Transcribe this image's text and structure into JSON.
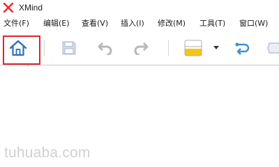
{
  "app": {
    "title": "XMind",
    "logo_icon": "xmind-logo-icon",
    "logo_color": "#e0312f"
  },
  "menu": {
    "items": [
      {
        "label": "文件(F)"
      },
      {
        "label": "编辑(E)"
      },
      {
        "label": "查看(V)"
      },
      {
        "label": "插入(I)"
      },
      {
        "label": "修改(M)"
      },
      {
        "label": "工具(T)"
      },
      {
        "label": "窗口(W)"
      }
    ]
  },
  "toolbar": {
    "buttons": [
      {
        "name": "home-icon"
      },
      {
        "name": "save-icon"
      },
      {
        "name": "undo-icon"
      },
      {
        "name": "redo-icon"
      },
      {
        "name": "topic-style-icon"
      },
      {
        "name": "dropdown-arrow-icon"
      },
      {
        "name": "relationship-icon"
      },
      {
        "name": "boundary-icon"
      }
    ],
    "highlight_color": "#e0232a"
  },
  "watermark": {
    "text": "tuhuaba.com"
  }
}
